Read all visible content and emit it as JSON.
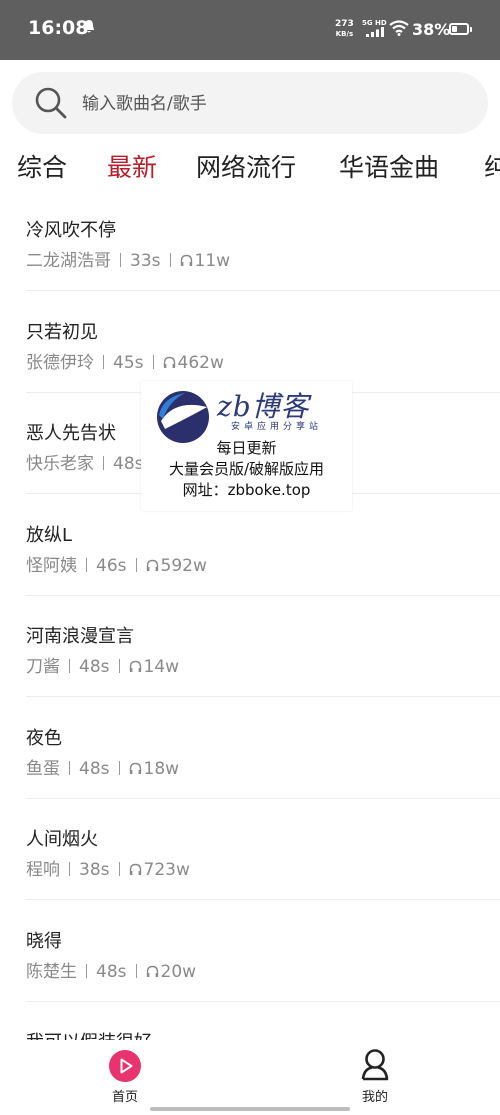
{
  "status_bar": {
    "time": "16:08",
    "net_speed_value": "273",
    "net_speed_unit": "KB/s",
    "network_type": "5G HD",
    "battery": "38%",
    "battery_level": 0.38
  },
  "search": {
    "placeholder": "输入歌曲名/歌手"
  },
  "tabs": [
    {
      "label": "综合",
      "active": false
    },
    {
      "label": "最新",
      "active": true
    },
    {
      "label": "网络流行",
      "active": false
    },
    {
      "label": "华语金曲",
      "active": false
    },
    {
      "label": "纯",
      "active": false
    }
  ],
  "songs": [
    {
      "title": "冷风吹不停",
      "artist": "二龙湖浩哥",
      "duration": "33s",
      "plays": "11w"
    },
    {
      "title": "只若初见",
      "artist": "张德伊玲",
      "duration": "45s",
      "plays": "462w"
    },
    {
      "title": "恶人先告状",
      "artist": "快乐老家",
      "duration": "48s",
      "plays": ""
    },
    {
      "title": "放纵L",
      "artist": "怪阿姨",
      "duration": "46s",
      "plays": "592w"
    },
    {
      "title": "河南浪漫宣言",
      "artist": "刀酱",
      "duration": "48s",
      "plays": "14w"
    },
    {
      "title": "夜色",
      "artist": "鱼蛋",
      "duration": "48s",
      "plays": "18w"
    },
    {
      "title": "人间烟火",
      "artist": "程响",
      "duration": "38s",
      "plays": "723w"
    },
    {
      "title": "晓得",
      "artist": "陈楚生",
      "duration": "48s",
      "plays": "20w"
    },
    {
      "title": "我可以假装很好",
      "artist": "",
      "duration": "",
      "plays": ""
    }
  ],
  "watermark": {
    "brand": "zb博客",
    "subtitle": "安卓应用分享站",
    "line1": "每日更新",
    "line2": "大量会员版/破解版应用",
    "line3": "网址：zbboke.top"
  },
  "bottom_nav": {
    "home_label": "首页",
    "mine_label": "我的",
    "accent": "#e8336e"
  },
  "colors": {
    "active_tab": "#b3202a",
    "status_bar_bg": "#5f5f5f"
  }
}
